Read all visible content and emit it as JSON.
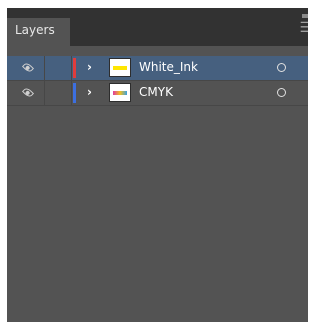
{
  "panel": {
    "tab_label": "Layers",
    "menu_icon": "panel-menu-icon"
  },
  "layers": [
    {
      "name": "White_Ink",
      "visible": true,
      "expanded": false,
      "selected": true,
      "color": "#e03c3c",
      "thumb_color": "#ffe600"
    },
    {
      "name": "CMYK",
      "visible": true,
      "expanded": false,
      "selected": false,
      "color": "#3c6fe0",
      "thumb_color": "#e03aa0"
    }
  ]
}
